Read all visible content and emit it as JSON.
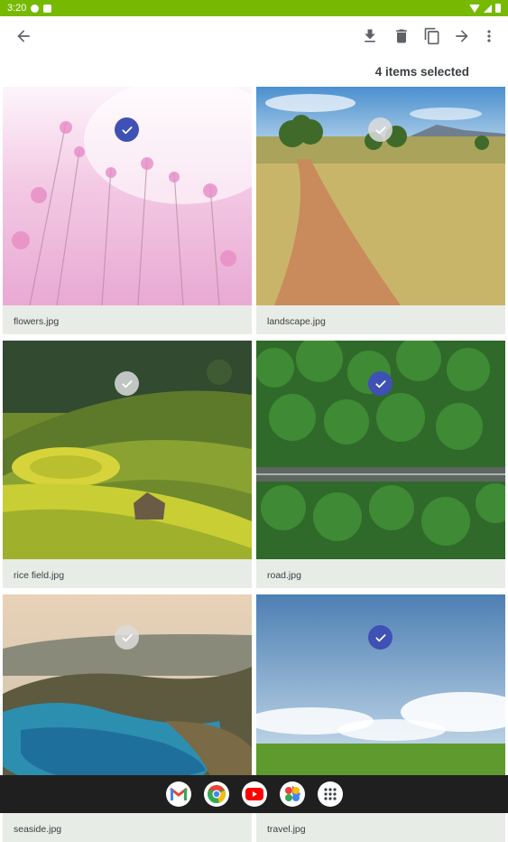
{
  "status_bar": {
    "time": "3:20"
  },
  "toolbar": {
    "back": "back-arrow-icon",
    "actions": [
      "download-icon",
      "delete-icon",
      "copy-icon",
      "move-icon",
      "more-vert-icon"
    ]
  },
  "selection": {
    "label": "4 items selected"
  },
  "files": [
    {
      "name": "flowers.jpg",
      "selected": true
    },
    {
      "name": "landscape.jpg",
      "selected": false
    },
    {
      "name": "rice field.jpg",
      "selected": false
    },
    {
      "name": "road.jpg",
      "selected": true
    },
    {
      "name": "seaside.jpg",
      "selected": false
    },
    {
      "name": "travel.jpg",
      "selected": true
    }
  ],
  "dock": {
    "apps": [
      "gmail-icon",
      "chrome-icon",
      "youtube-icon",
      "photos-icon",
      "app-drawer-icon"
    ]
  },
  "colors": {
    "status_bar": "#76b900",
    "selected_check": "#3f51b5",
    "caption_bg": "#e8ece6",
    "nav_bar": "#1f1f1f"
  }
}
